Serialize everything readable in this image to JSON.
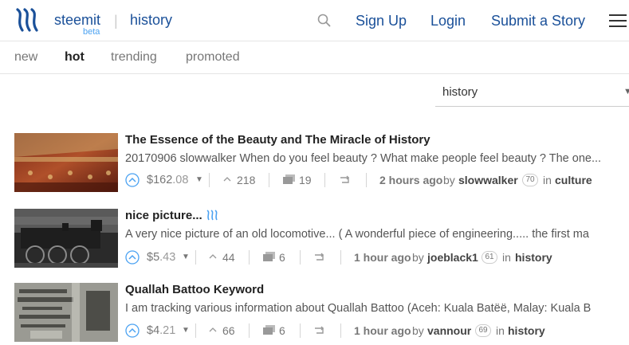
{
  "header": {
    "brand": "steemit",
    "beta": "beta",
    "separator": "|",
    "section": "history",
    "nav": [
      "Sign Up",
      "Login",
      "Submit a Story"
    ],
    "brand_color": "#1a5099",
    "accent_color": "#4ba2f2"
  },
  "subnav": [
    "new",
    "hot",
    "trending",
    "promoted"
  ],
  "subnav_active": "hot",
  "filter": {
    "selected": "history"
  },
  "posts": [
    {
      "title": "The Essence of the Beauty and The Miracle of History",
      "summary": "20170906 slowwalker When do you feel beauty ? What make people feel beauty ? The one...",
      "payout_int": "$162",
      "payout_dec": ".08",
      "votes": "218",
      "comments": "19",
      "time": "2 hours ago",
      "by": "by",
      "author": "slowwalker",
      "rep": "70",
      "in": "in",
      "category": "culture"
    },
    {
      "title": "nice picture...",
      "summary": "A very nice picture of an old locomotive... ( A wonderful piece of engineering..... the first ma",
      "payout_int": "$5",
      "payout_dec": ".43",
      "votes": "44",
      "comments": "6",
      "time": "1 hour ago",
      "by": "by",
      "author": "joeblack1",
      "rep": "61",
      "in": "in",
      "category": "history"
    },
    {
      "title": "Quallah Battoo Keyword",
      "summary": "I am tracking various information about Quallah Battoo (Aceh: Kuala Batëë, Malay: Kuala B",
      "payout_int": "$4",
      "payout_dec": ".21",
      "votes": "66",
      "comments": "6",
      "time": "1 hour ago",
      "by": "by",
      "author": "vannour",
      "rep": "69",
      "in": "in",
      "category": "history"
    }
  ]
}
